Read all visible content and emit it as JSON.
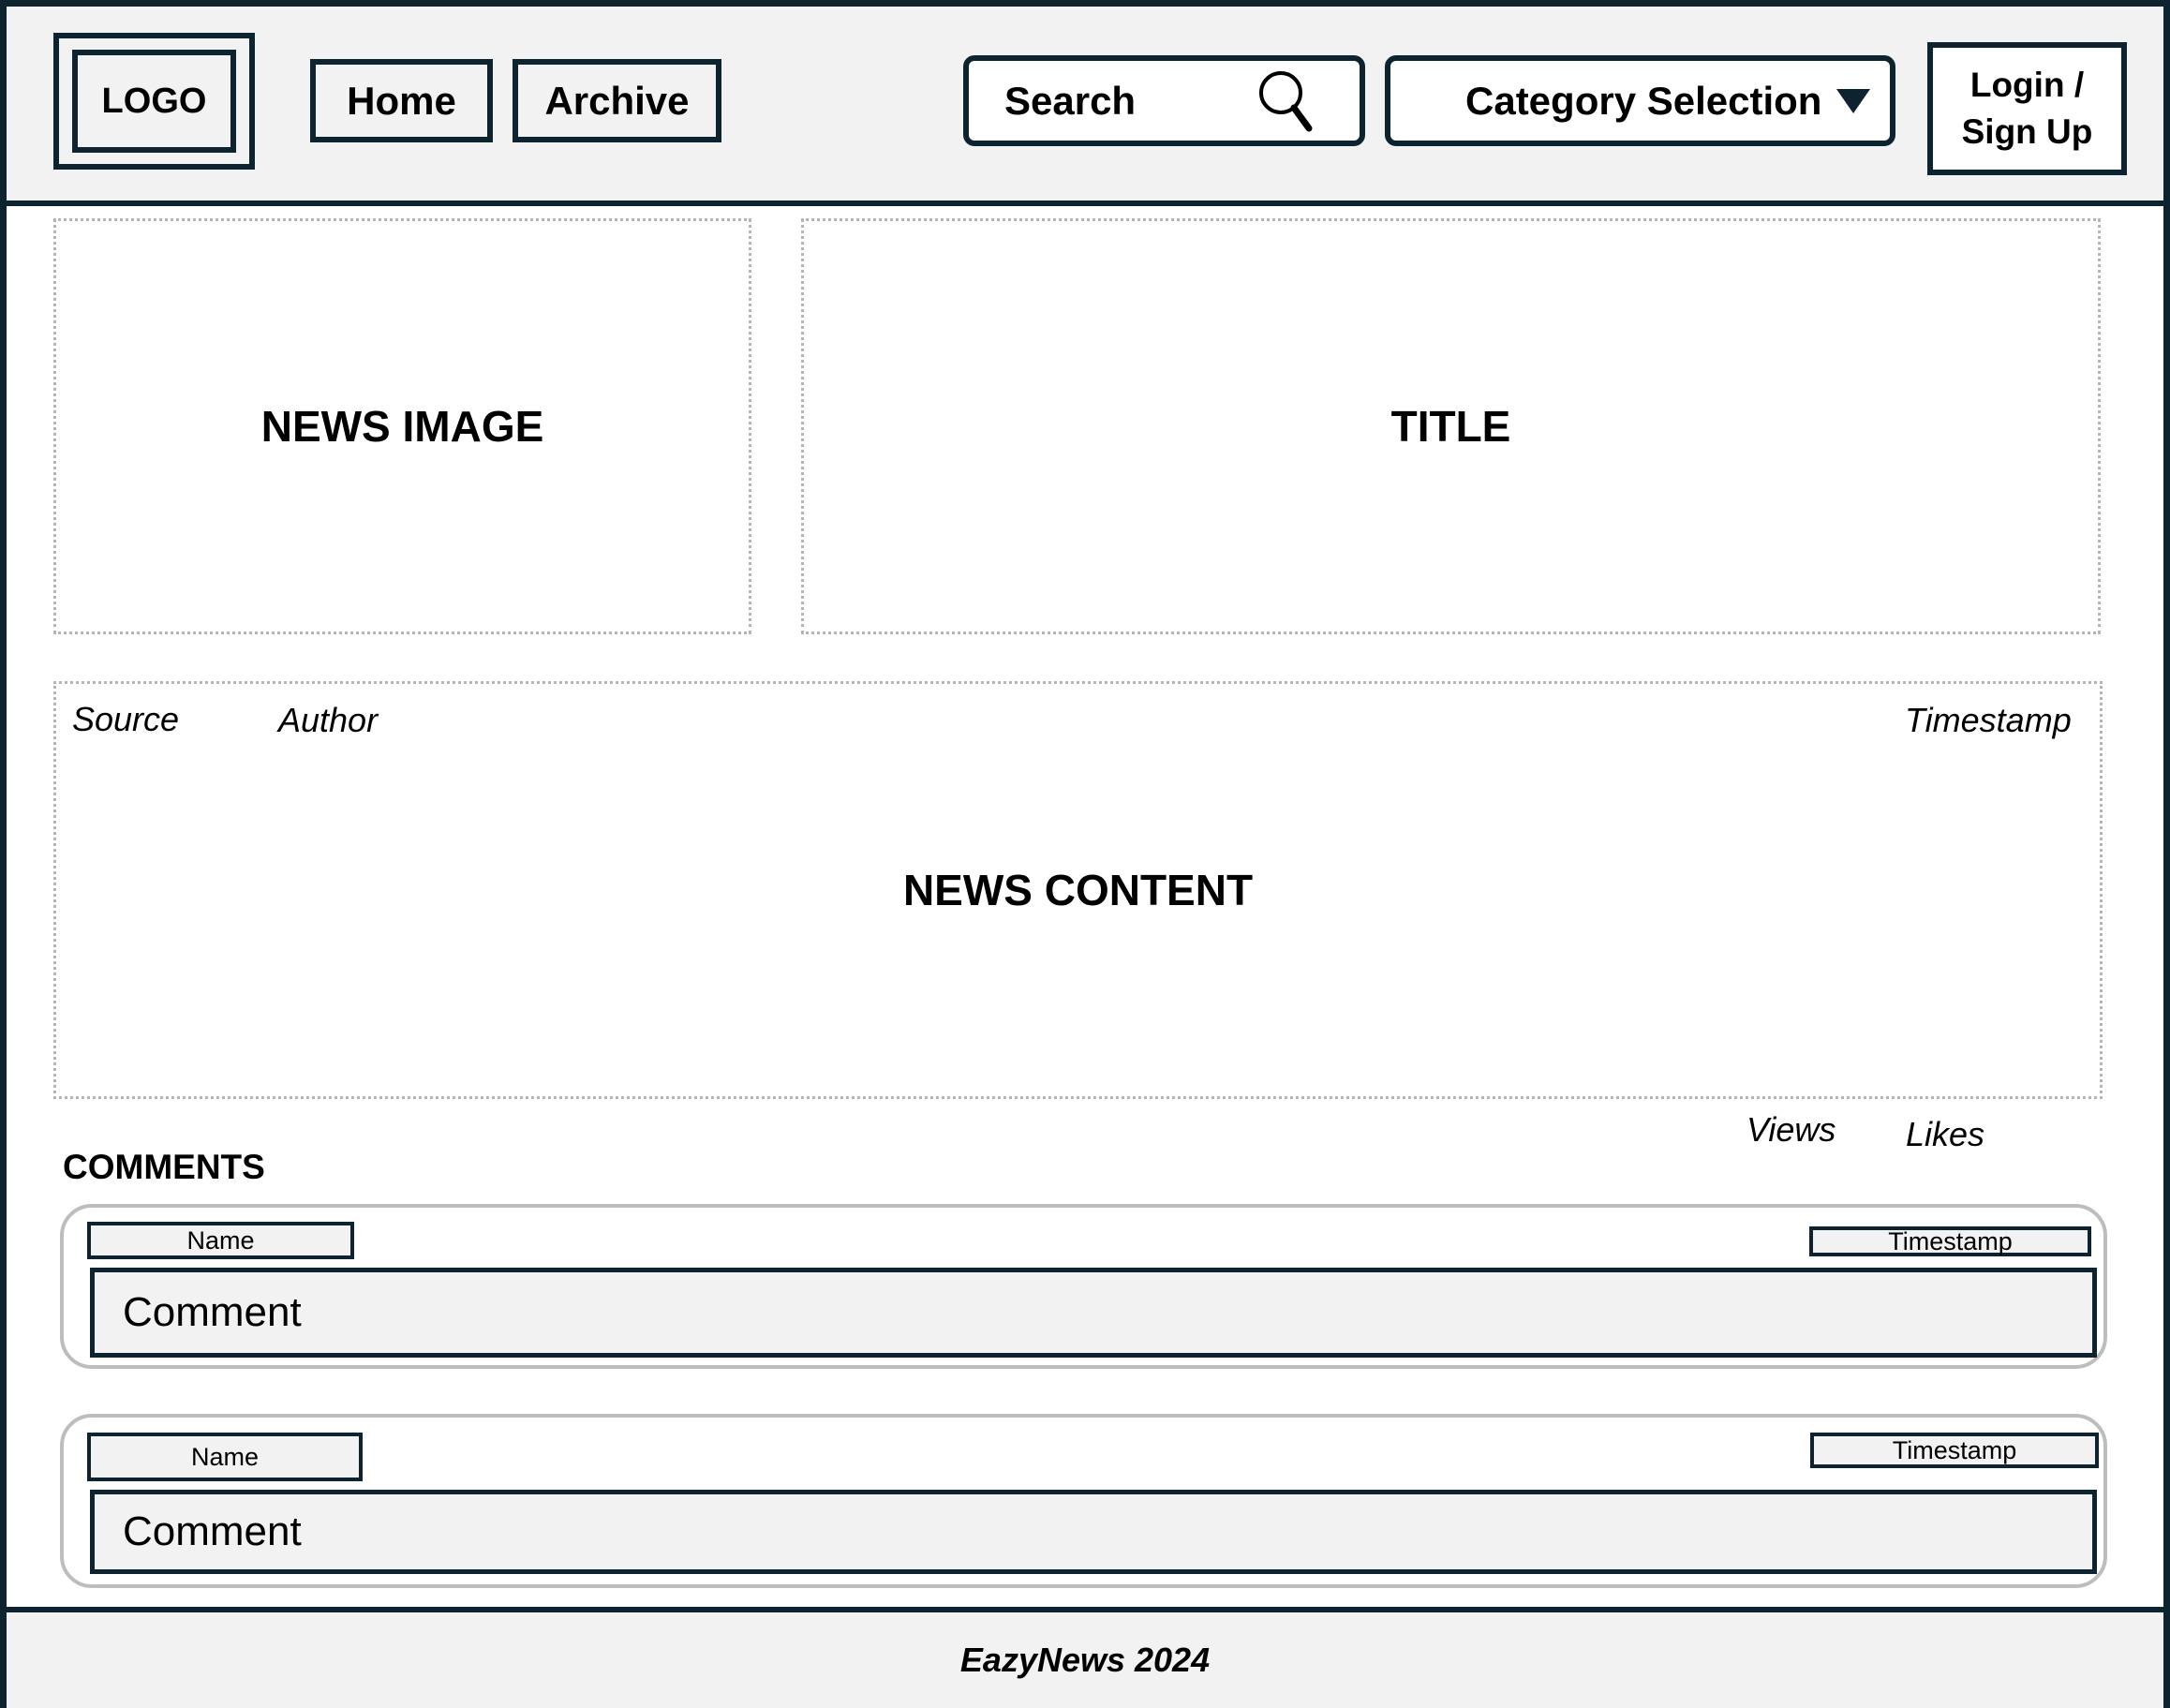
{
  "header": {
    "logo_label": "LOGO",
    "nav": [
      {
        "label": "Home"
      },
      {
        "label": "Archive"
      }
    ],
    "search": {
      "label": "Search",
      "icon": "search-icon"
    },
    "category": {
      "label": "Category Selection",
      "icon": "triangle-down-icon"
    },
    "login": {
      "line1": "Login /",
      "line2": "Sign Up"
    }
  },
  "article": {
    "image_label": "NEWS IMAGE",
    "title_label": "TITLE",
    "source": "Source",
    "author": "Author",
    "timestamp": "Timestamp",
    "content_label": "NEWS CONTENT",
    "views": "Views",
    "likes": "Likes"
  },
  "comments": {
    "heading": "COMMENTS",
    "items": [
      {
        "name": "Name",
        "timestamp": "Timestamp",
        "comment": "Comment"
      },
      {
        "name": "Name",
        "timestamp": "Timestamp",
        "comment": "Comment"
      }
    ]
  },
  "footer": {
    "text": "EazyNews 2024"
  },
  "colors": {
    "border": "#0d2430",
    "panel_bg": "#f2f2f2",
    "dotted": "#b5b5b5",
    "card_border": "#bdbdbd"
  }
}
